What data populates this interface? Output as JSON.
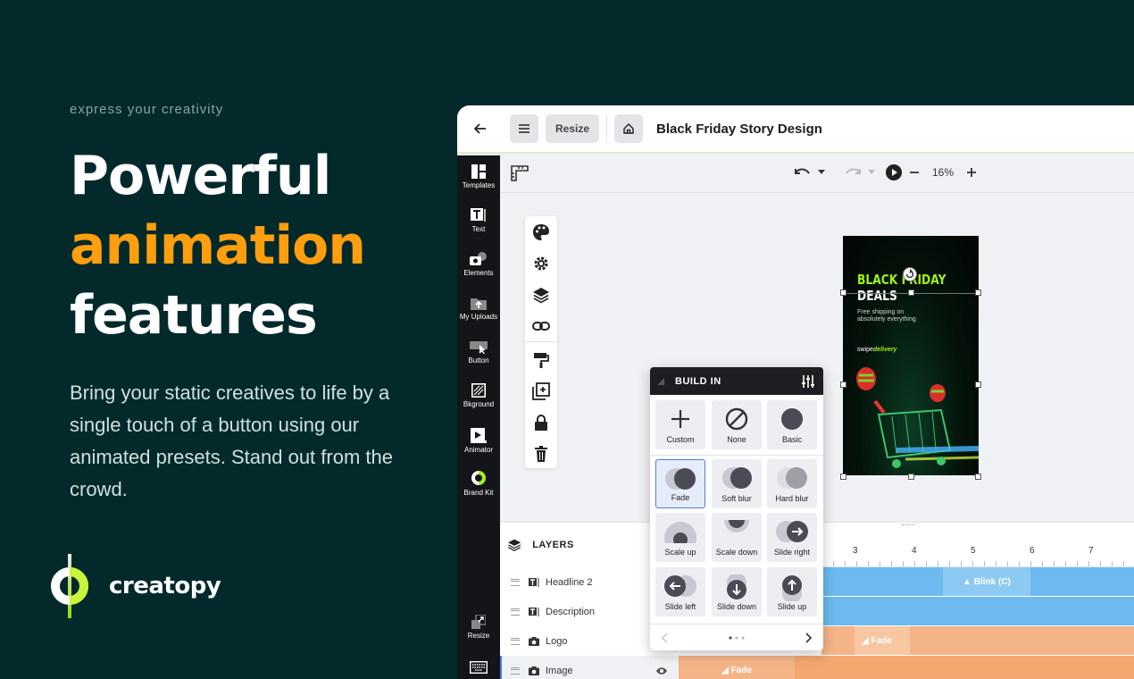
{
  "hero": {
    "eyebrow": "express your creativity",
    "line1": "Powerful",
    "line2": "animation",
    "line3": "features",
    "subcopy": "Bring your static creatives to life by a single touch of a button using our animated presets. Stand out from the crowd.",
    "brand": "creatopy"
  },
  "colors": {
    "background": "#03292b",
    "accent": "#ff9e0f",
    "track_blue": "#6cbaf0",
    "track_orange": "#f5b487",
    "story_green": "#9ef01a"
  },
  "app": {
    "resize_label": "Resize",
    "doc_title": "Black Friday Story Design",
    "zoom": "16%"
  },
  "sidebar": {
    "items": [
      {
        "label": "Templates",
        "icon": "templates-icon"
      },
      {
        "label": "Text",
        "icon": "text-icon"
      },
      {
        "label": "Elements",
        "icon": "elements-icon"
      },
      {
        "label": "My Uploads",
        "icon": "upload-icon"
      },
      {
        "label": "Button",
        "icon": "button-icon"
      },
      {
        "label": "Bkground",
        "icon": "background-icon"
      },
      {
        "label": "Animator",
        "icon": "animator-icon"
      },
      {
        "label": "Brand Kit",
        "icon": "brand-kit-icon"
      },
      {
        "label": "Resize",
        "icon": "resize-icon"
      }
    ]
  },
  "story": {
    "title_line1": "BLACK FRIDAY",
    "title_line2": "DEALS",
    "subtitle_line1": "Free shipping on",
    "subtitle_line2": "absolutely everything",
    "logo_a": "swipe",
    "logo_b": "delivery"
  },
  "timeline": {
    "title": "LAYERS",
    "ticks": [
      "3",
      "4",
      "5",
      "6",
      "7"
    ],
    "layers": [
      {
        "name": "Headline 2"
      },
      {
        "name": "Description"
      },
      {
        "name": "Logo"
      },
      {
        "name": "Image"
      }
    ],
    "tracks": {
      "blink_label": "Blink (C)",
      "logo_fade": "Fade",
      "image_fade": "Fade"
    }
  },
  "buildin": {
    "title": "BUILD IN",
    "presets": [
      "Custom",
      "None",
      "Basic",
      "Fade",
      "Soft blur",
      "Hard blur",
      "Scale up",
      "Scale down",
      "Slide right",
      "Slide left",
      "Slide down",
      "Slide up"
    ],
    "selected": "Fade"
  }
}
